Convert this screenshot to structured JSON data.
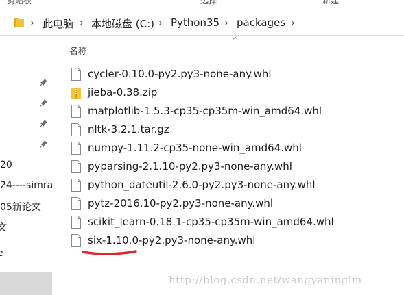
{
  "ribbon": {
    "left_label": "剪贴板",
    "middle_label": "选择",
    "right_label": "新建"
  },
  "address_bar": {
    "breadcrumbs": [
      "此电脑",
      "本地磁盘 (C:)",
      "Python35",
      "packages"
    ],
    "separator": "›"
  },
  "nav_pane": {
    "items": [
      "20",
      "24----simra",
      "05新论文",
      "文",
      "e"
    ]
  },
  "file_list": {
    "column_header": "名称",
    "sort_indicator": "^",
    "files": [
      {
        "name": "cycler-0.10.0-py2.py3-none-any.whl",
        "type": "file"
      },
      {
        "name": "jieba-0.38.zip",
        "type": "zip"
      },
      {
        "name": "matplotlib-1.5.3-cp35-cp35m-win_amd64.whl",
        "type": "file"
      },
      {
        "name": "nltk-3.2.1.tar.gz",
        "type": "file"
      },
      {
        "name": "numpy-1.11.2-cp35-none-win_amd64.whl",
        "type": "file"
      },
      {
        "name": "pyparsing-2.1.10-py2.py3-none-any.whl",
        "type": "file"
      },
      {
        "name": "python_dateutil-2.6.0-py2.py3-none-any.whl",
        "type": "file"
      },
      {
        "name": "pytz-2016.10-py2.py3-none-any.whl",
        "type": "file"
      },
      {
        "name": "scikit_learn-0.18.1-cp35-cp35m-win_amd64.whl",
        "type": "file"
      },
      {
        "name": "six-1.10.0-py2.py3-none-any.whl",
        "type": "file"
      }
    ]
  },
  "watermark": "http://blog.csdn.net/wangyaninglm",
  "colors": {
    "folder_yellow": "#f3c33b",
    "annotation_red": "#e0262b",
    "selection_gray": "#d9d9d9"
  }
}
